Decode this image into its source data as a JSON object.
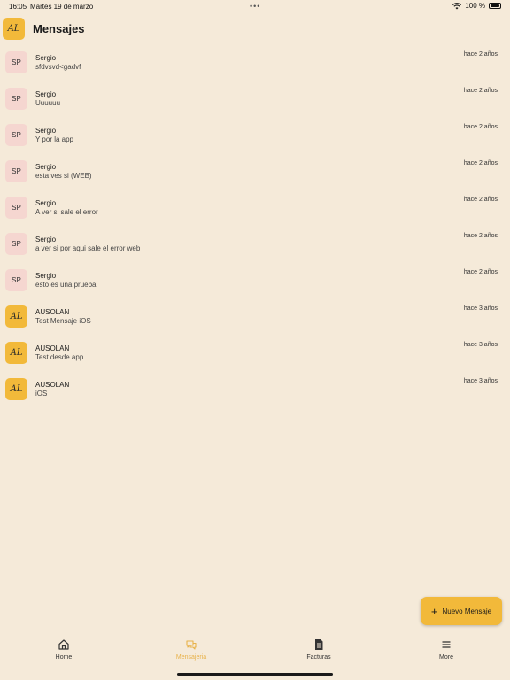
{
  "status_bar": {
    "time": "16:05",
    "date": "Martes 19 de marzo",
    "battery": "100 %"
  },
  "header": {
    "logo_text": "AL",
    "title": "Mensajes"
  },
  "messages": [
    {
      "avatar": "SP",
      "type": "sp",
      "sender": "Sergio",
      "preview": "sfdvsvd<gadvf",
      "time": "hace 2 años"
    },
    {
      "avatar": "SP",
      "type": "sp",
      "sender": "Sergio",
      "preview": "Uuuuuu",
      "time": "hace 2 años"
    },
    {
      "avatar": "SP",
      "type": "sp",
      "sender": "Sergio",
      "preview": "Y por la app",
      "time": "hace 2 años"
    },
    {
      "avatar": "SP",
      "type": "sp",
      "sender": "Sergio",
      "preview": "esta ves si (WEB)",
      "time": "hace 2 años"
    },
    {
      "avatar": "SP",
      "type": "sp",
      "sender": "Sergio",
      "preview": "A ver si sale el error",
      "time": "hace 2 años"
    },
    {
      "avatar": "SP",
      "type": "sp",
      "sender": "Sergio",
      "preview": "a ver si por aqui sale el error web",
      "time": "hace 2 años"
    },
    {
      "avatar": "SP",
      "type": "sp",
      "sender": "Sergio",
      "preview": "esto es una prueba",
      "time": "hace 2 años"
    },
    {
      "avatar": "AL",
      "type": "au",
      "sender": "AUSOLAN",
      "preview": "Test Mensaje iOS",
      "time": "hace 3 años"
    },
    {
      "avatar": "AL",
      "type": "au",
      "sender": "AUSOLAN",
      "preview": "Test desde app",
      "time": "hace 3 años"
    },
    {
      "avatar": "AL",
      "type": "au",
      "sender": "AUSOLAN",
      "preview": "iOS",
      "time": "hace 3 años"
    }
  ],
  "fab": {
    "label": "Nuevo Mensaje"
  },
  "tabs": [
    {
      "label": "Home",
      "icon": "home-icon"
    },
    {
      "label": "Mensajeria",
      "icon": "chat-icon",
      "active": true
    },
    {
      "label": "Facturas",
      "icon": "document-icon"
    },
    {
      "label": "More",
      "icon": "menu-icon"
    }
  ],
  "colors": {
    "background": "#f5ead9",
    "accent": "#f2b93a",
    "sp_avatar": "#f5d6d0",
    "active_tab": "#e8b24a"
  }
}
